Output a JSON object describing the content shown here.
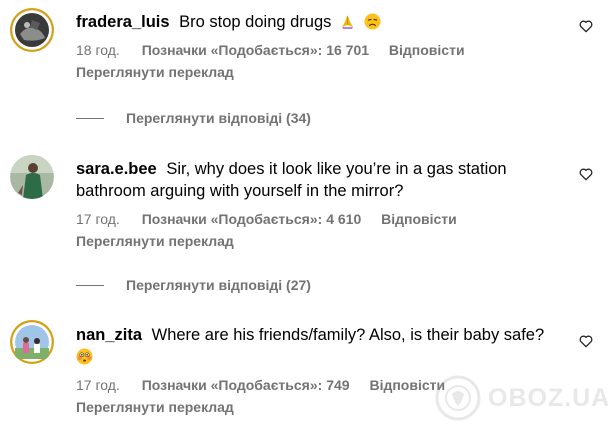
{
  "comments": [
    {
      "username": "fradera_luis",
      "text": "Bro stop doing drugs",
      "time": "18 год.",
      "likes": "Позначки «Подобається»: 16 701",
      "reply": "Відповісти",
      "translate": "Переглянути переклад",
      "replies": "Переглянути відповіді (34)",
      "emojis": [
        "folded-hands-emoji",
        "disappointed-face-emoji"
      ]
    },
    {
      "username": "sara.e.bee",
      "text_line1": "Sir, why does it look like you’re in a gas station",
      "text_line2": "bathroom arguing with yourself in the mirror?",
      "time": "17 год.",
      "likes": "Позначки «Подобається»: 4 610",
      "reply": "Відповісти",
      "translate": "Переглянути переклад",
      "replies": "Переглянути відповіді (27)"
    },
    {
      "username": "nan_zita",
      "text": "Where are his friends/family? Also, is their baby safe?",
      "time": "17 год.",
      "likes": "Позначки «Подобається»: 749",
      "reply": "Відповісти",
      "translate": "Переглянути переклад",
      "emojis": [
        "flushed-face-emoji"
      ]
    }
  ],
  "watermark": {
    "text": "OBOZ.UA"
  },
  "colors": {
    "text": "#000000",
    "muted": "#737373",
    "background": "#ffffff"
  }
}
